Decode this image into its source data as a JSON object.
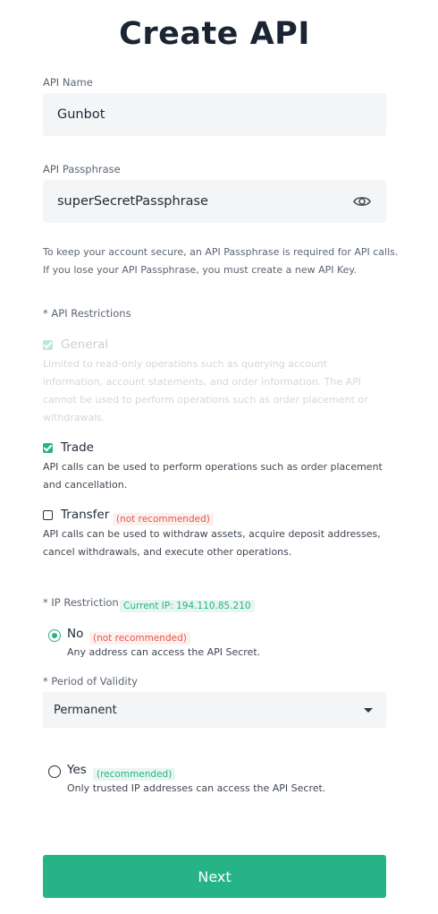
{
  "title": "Create API",
  "api_name": {
    "label": "API Name",
    "value": "Gunbot"
  },
  "passphrase": {
    "label": "API Passphrase",
    "value": "superSecretPassphrase",
    "note_line1": "To keep your account secure, an API Passphrase is required for API calls.",
    "note_line2": "If you lose your API Passphrase, you must create a new API Key."
  },
  "restrictions": {
    "label": "* API Restrictions",
    "general": {
      "label": "General",
      "desc": [
        "Limited to read-only operations such as querying account",
        "information, account statements, and order information. The API",
        "cannot be used to perform operations such as order placement or",
        "withdrawals."
      ]
    },
    "trade": {
      "label": "Trade",
      "desc": [
        "API calls can be used to perform operations such as order placement",
        "and cancellation."
      ]
    },
    "transfer": {
      "label": "Transfer",
      "badge": "(not recommended)",
      "desc": [
        "API calls can be used to withdraw assets, acquire deposit addresses,",
        "cancel withdrawals, and execute other operations."
      ]
    }
  },
  "ip_restriction": {
    "label": "* IP Restriction",
    "current_ip": "Current IP:  194.110.85.210",
    "no": {
      "label": "No",
      "badge": "(not recommended)",
      "desc": "Any address can access the API Secret."
    },
    "yes": {
      "label": "Yes",
      "badge": "(recommended)",
      "desc": "Only trusted IP addresses can access the API Secret."
    }
  },
  "validity": {
    "label": "* Period of Validity",
    "value": "Permanent"
  },
  "next_button": "Next",
  "colors": {
    "accent": "#26b386",
    "warning": "#e05a4e",
    "field_bg": "#f3f5f6"
  },
  "icons": {
    "visibility": "eye-icon",
    "dropdown": "caret-down-icon",
    "check": "check-icon"
  }
}
